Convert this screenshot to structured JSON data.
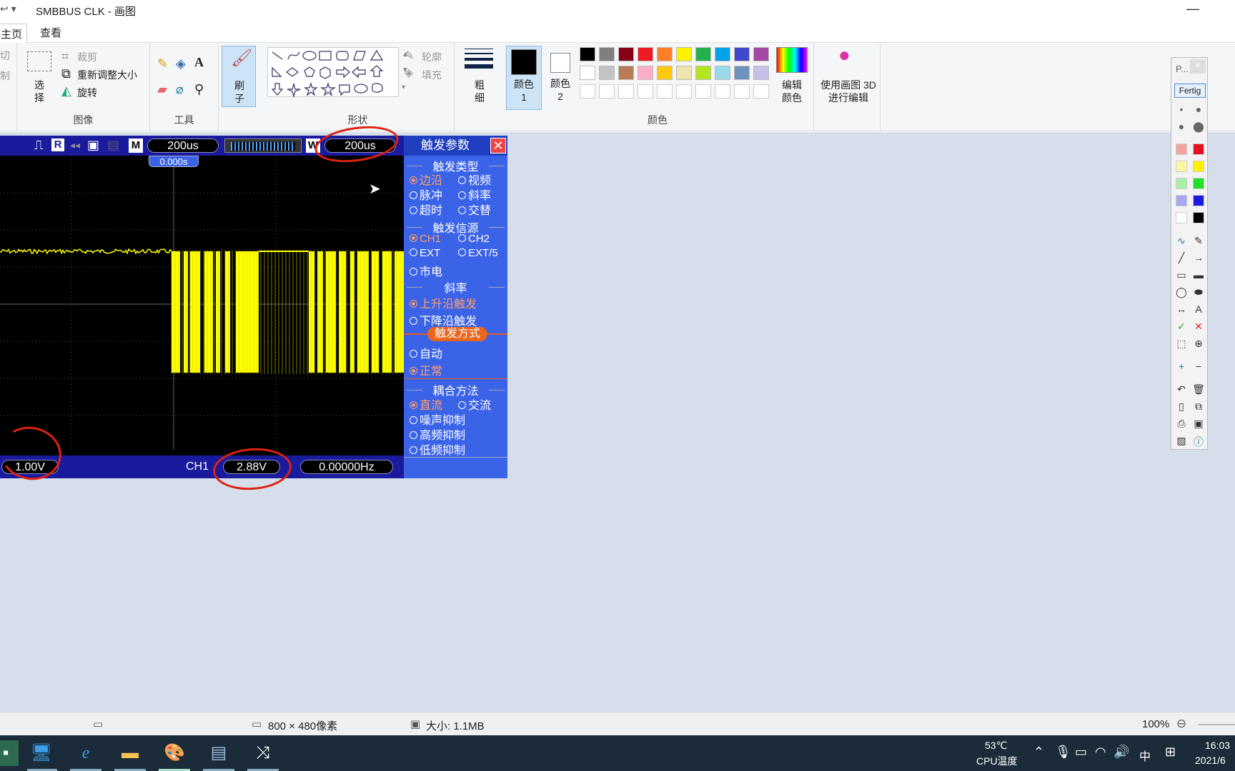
{
  "window": {
    "title": "SMBBUS CLK - 画图",
    "minimize_glyph": "—"
  },
  "tabs": [
    {
      "label": "主页"
    },
    {
      "label": "查看"
    }
  ],
  "ribbon": {
    "clipboard": {
      "cut": "切",
      "copy": "制"
    },
    "image": {
      "select": "选择",
      "crop": "裁剪",
      "resize": "重新调整大小",
      "rotate": "旋转",
      "group": "图像"
    },
    "tools": {
      "group": "工具"
    },
    "brush": {
      "label": "刷子"
    },
    "shapes": {
      "outline": "轮廓",
      "fill": "填充",
      "group": "形状"
    },
    "size": {
      "label": "粗细"
    },
    "color1": {
      "label": "颜色 1"
    },
    "color2": {
      "label": "颜色 2"
    },
    "colors": {
      "group": "颜色",
      "edit": "编辑颜色"
    },
    "paint3d": {
      "label": "使用画图 3D 进行编辑"
    }
  },
  "palette_colors": [
    "#000000",
    "#7f7f7f",
    "#880015",
    "#ed1c24",
    "#ff7f27",
    "#fff200",
    "#22b14c",
    "#00a2e8",
    "#3f48cc",
    "#a349a4",
    "#ffffff",
    "#c3c3c3",
    "#b97a57",
    "#ffaec9",
    "#ffc90e",
    "#efe4b0",
    "#b5e61d",
    "#99d9ea",
    "#7092be",
    "#c8bfe7"
  ],
  "scope": {
    "mode_M": "M",
    "timebase": "200us",
    "mode_W": "W",
    "timebase2": "200us",
    "trig_pos": "0.000s",
    "ch_volt": "1.00V",
    "ch_label": "CH1",
    "trig_level": "2.88V",
    "freq": "0.00000Hz",
    "trig_panel": {
      "title": "触发参数",
      "close": "✕",
      "type_title": "触发类型",
      "type_opts": [
        "边沿",
        "视频",
        "脉冲",
        "斜率",
        "超时",
        "交替"
      ],
      "src_title": "触发信源",
      "src_opts": [
        "CH1",
        "CH2",
        "EXT",
        "EXT/5",
        "市电"
      ],
      "slope_title": "斜率",
      "slope_opts": [
        "上升沿触发",
        "下降沿触发"
      ],
      "mode_title": "触发方式",
      "mode_opts": [
        "自动",
        "正常"
      ],
      "coupling_title": "耦合方法",
      "coupling_opts": [
        "直流",
        "交流",
        "噪声抑制",
        "高频抑制",
        "低频抑制"
      ]
    }
  },
  "statusbar": {
    "dims": "800 × 480像素",
    "size": "大小: 1.1MB",
    "zoom": "100%"
  },
  "taskbar": {
    "temp": "53℃",
    "temp_label": "CPU温度",
    "ime": "中",
    "time": "16:03",
    "date": "2021/6"
  },
  "sidepal": {
    "title": "P...",
    "done": "Fertig"
  }
}
